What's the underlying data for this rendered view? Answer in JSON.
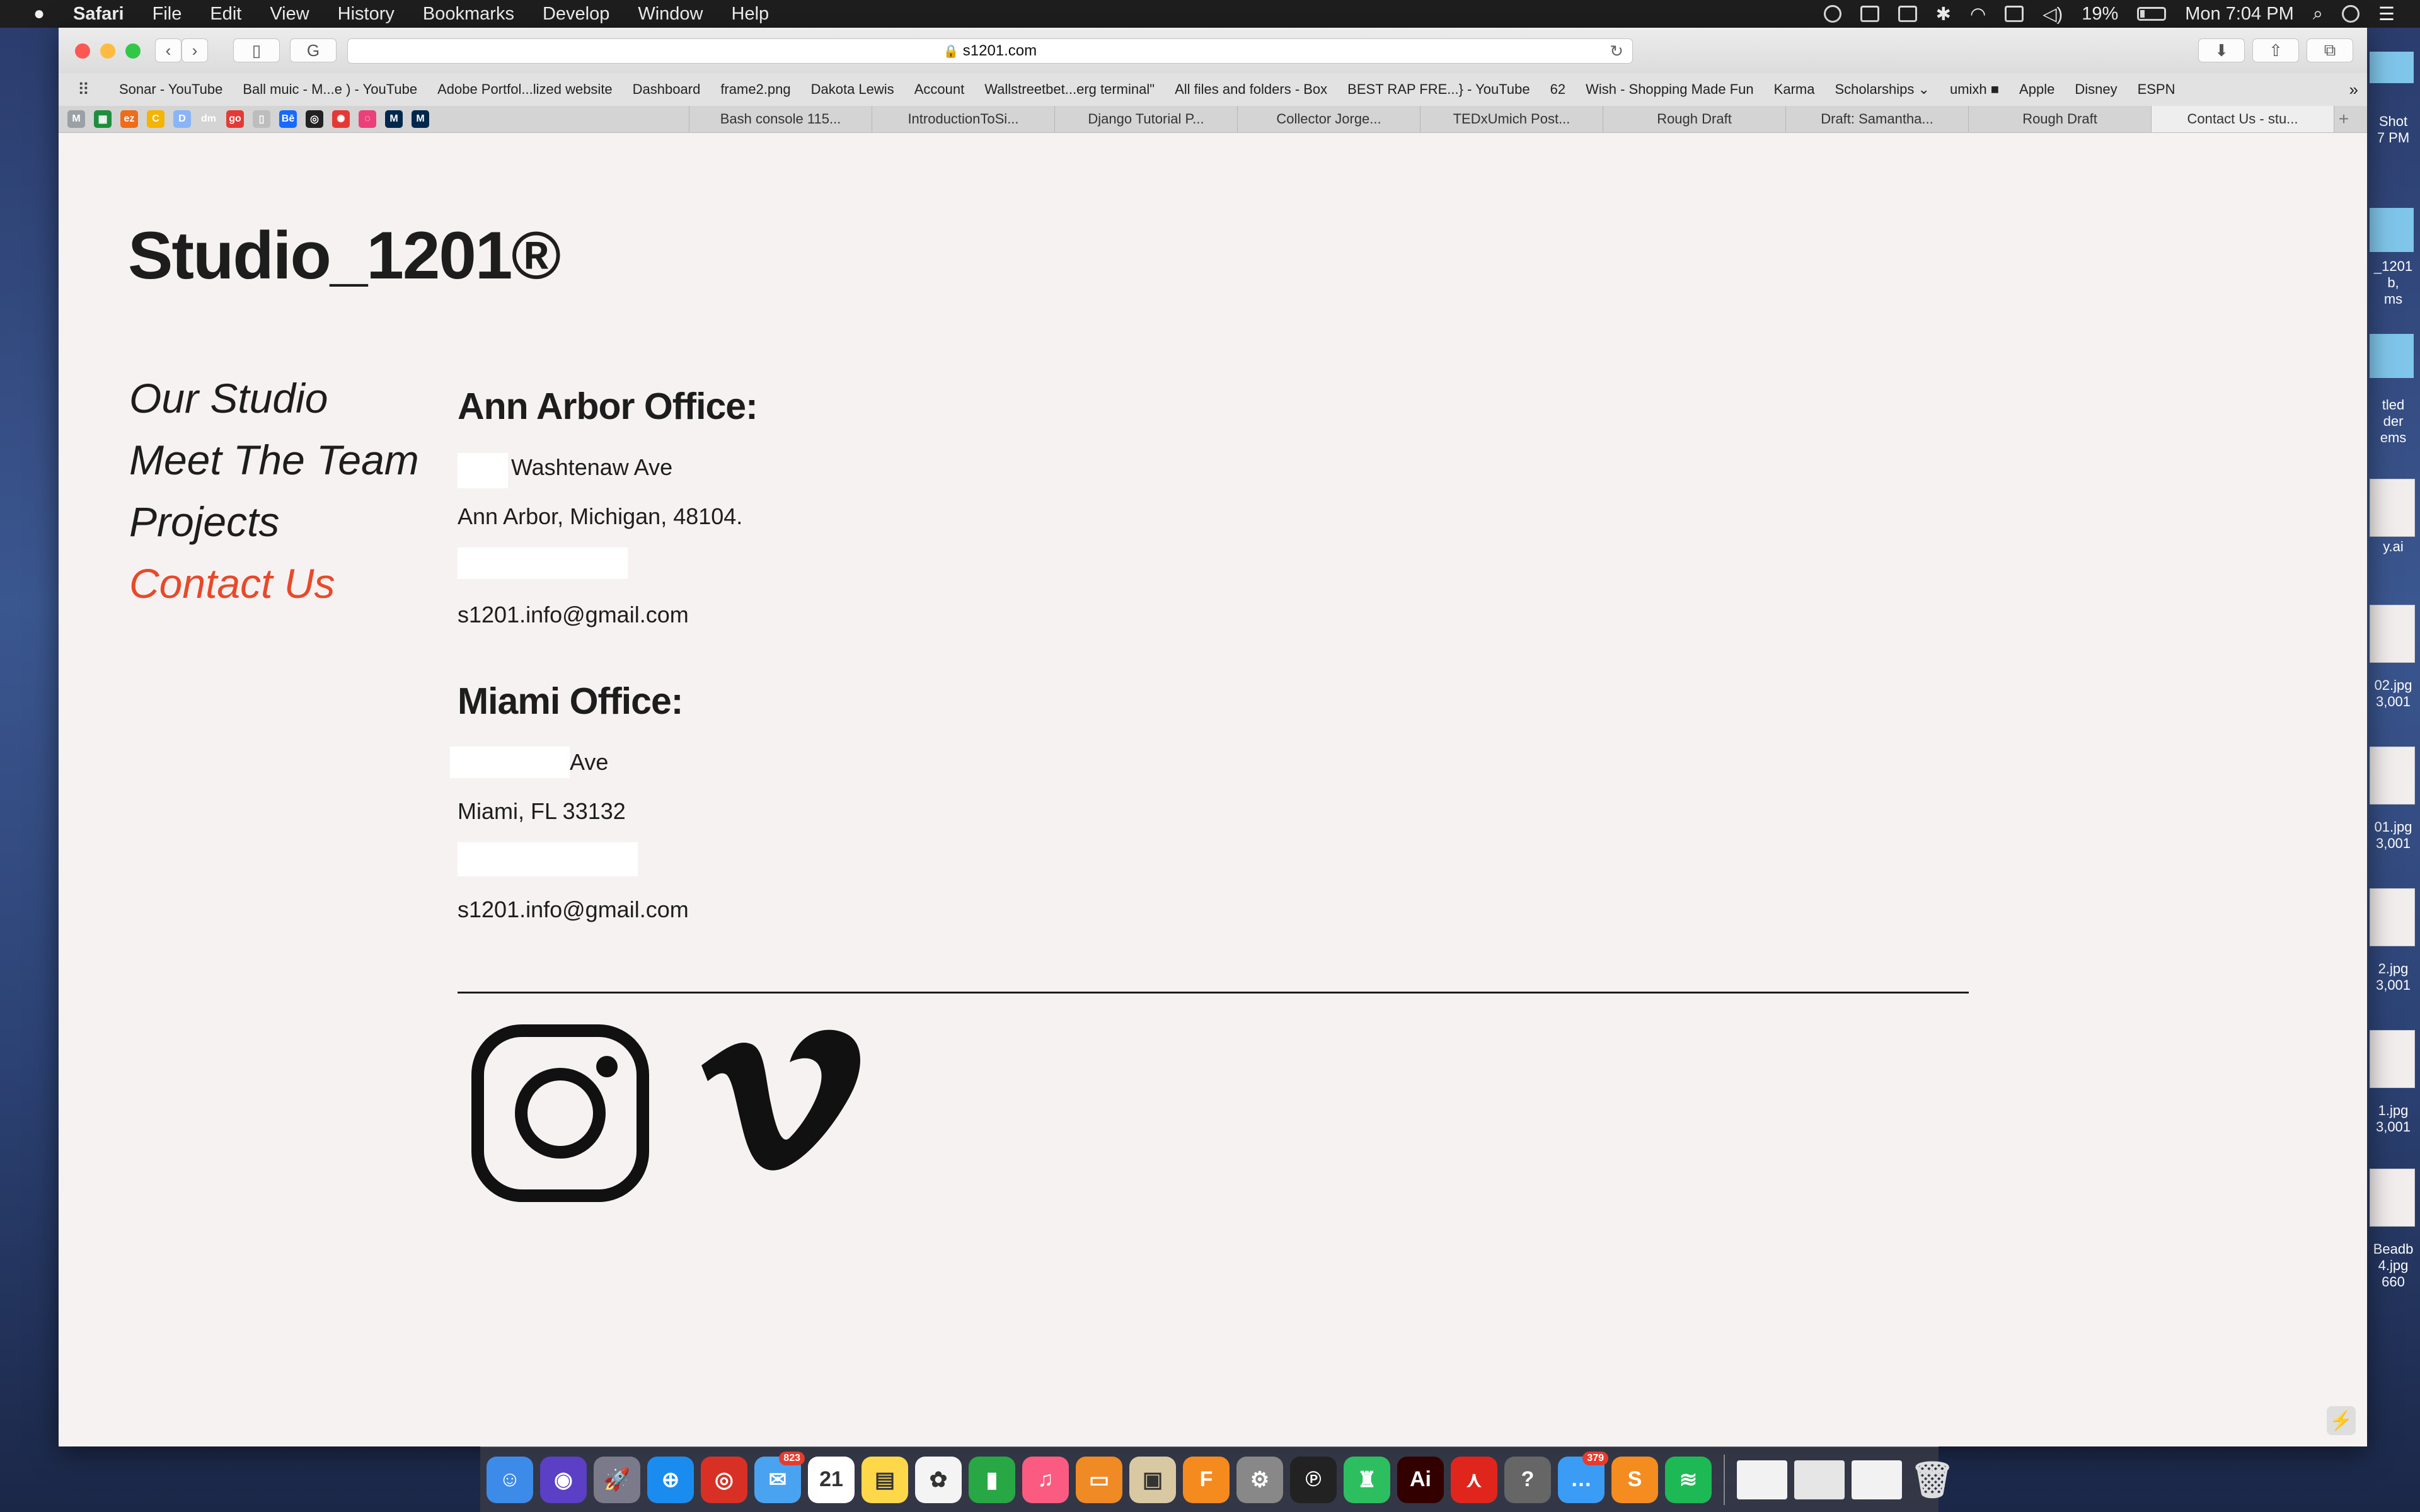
{
  "menubar": {
    "apple": "",
    "app_name": "Safari",
    "menus": [
      "File",
      "Edit",
      "View",
      "History",
      "Bookmarks",
      "Develop",
      "Window",
      "Help"
    ],
    "battery": "19%",
    "clock": "Mon 7:04 PM"
  },
  "browser": {
    "url": "s1201.com",
    "bookmarks": [
      "Sonar - YouTube",
      "Ball muic - M...e ) - YouTube",
      "Adobe Portfol...lized website",
      "Dashboard",
      "frame2.png",
      "Dakota Lewis",
      "Account",
      "Wallstreetbet...erg terminal\"",
      "All files and folders - Box",
      "BEST RAP FRE...} - YouTube",
      "62",
      "Wish - Shopping Made Fun",
      "Karma",
      "Scholarships ⌄",
      "umixh ■",
      "Apple",
      "Disney",
      "ESPN"
    ],
    "pinned_tabs": [
      {
        "label": "M",
        "color": "#9aa0a6"
      },
      {
        "label": "▦",
        "color": "#1e8e3e"
      },
      {
        "label": "ez",
        "color": "#ef6c1a"
      },
      {
        "label": "C",
        "color": "#f4b400"
      },
      {
        "label": "D",
        "color": "#8ab4f8"
      },
      {
        "label": "dm",
        "color": "#d4d4d4"
      },
      {
        "label": "go",
        "color": "#e53935"
      },
      {
        "label": "▯",
        "color": "#bdbdbd"
      },
      {
        "label": "Bē",
        "color": "#1769ff"
      },
      {
        "label": "◎",
        "color": "#222222"
      },
      {
        "label": "✺",
        "color": "#e53935"
      },
      {
        "label": "◌",
        "color": "#ec407a"
      },
      {
        "label": "M",
        "color": "#00274c"
      },
      {
        "label": "M",
        "color": "#00274c"
      }
    ],
    "tabs": [
      "Bash console 115...",
      "IntroductionToSi...",
      "Django Tutorial P...",
      "Collector Jorge...",
      "TEDxUmich Post...",
      "Rough Draft",
      "Draft: Samantha...",
      "Rough Draft",
      "Contact Us - stu..."
    ],
    "active_tab_index": 8
  },
  "site": {
    "logo": "Studio_1201®",
    "nav": [
      "Our Studio",
      "Meet The Team",
      "Projects",
      "Contact Us"
    ],
    "active_nav": "Contact Us",
    "accent_color": "#e8492a",
    "offices": [
      {
        "heading": "Ann Arbor Office:",
        "street": "Washtenaw Ave",
        "city": "Ann Arbor, Michigan, 48104.",
        "email": "s1201.info@gmail.com"
      },
      {
        "heading": "Miami Office:",
        "street": "Ave",
        "city": "Miami, FL 33132",
        "email": "s1201.info@gmail.com"
      }
    ],
    "social": [
      "instagram-icon",
      "vimeo-icon"
    ]
  },
  "desktop_files": [
    "Shot\n7 PM",
    "_1201\nb,\nms",
    "tled\nder\nems",
    "y.ai",
    "02.jpg\n3,001",
    "01.jpg\n3,001",
    "2.jpg\n3,001",
    "1.jpg\n3,001",
    "Beadb\n4.jpg\n660"
  ],
  "dock": {
    "apps": [
      {
        "name": "finder",
        "label": "☺",
        "color": "#3d8be8"
      },
      {
        "name": "siri",
        "label": "◉",
        "color": "#5b3fc4"
      },
      {
        "name": "launchpad",
        "label": "🚀",
        "color": "#7a7a8a"
      },
      {
        "name": "safari",
        "label": "⊕",
        "color": "#1a8cf0"
      },
      {
        "name": "chrome",
        "label": "◎",
        "color": "#d93025"
      },
      {
        "name": "mail",
        "label": "✉",
        "color": "#4aa3f0",
        "badge": "823"
      },
      {
        "name": "calendar",
        "label": "21",
        "color": "#ffffff"
      },
      {
        "name": "notes",
        "label": "▤",
        "color": "#ffd84a"
      },
      {
        "name": "photos",
        "label": "✿",
        "color": "#f4f4f4"
      },
      {
        "name": "numbers",
        "label": "▮",
        "color": "#28a745"
      },
      {
        "name": "itunes",
        "label": "♫",
        "color": "#fb5b80"
      },
      {
        "name": "books",
        "label": "▭",
        "color": "#f08a24"
      },
      {
        "name": "preview",
        "label": "▣",
        "color": "#d9c9a3"
      },
      {
        "name": "fusion",
        "label": "F",
        "color": "#f58a1f"
      },
      {
        "name": "settings",
        "label": "⚙",
        "color": "#888888"
      },
      {
        "name": "pycharm",
        "label": "℗",
        "color": "#222222"
      },
      {
        "name": "evernote",
        "label": "♜",
        "color": "#2dbe60"
      },
      {
        "name": "illustrator",
        "label": "Ai",
        "color": "#330000"
      },
      {
        "name": "acrobat",
        "label": "⋏",
        "color": "#e0261c"
      },
      {
        "name": "help",
        "label": "?",
        "color": "#666666"
      },
      {
        "name": "messages",
        "label": "…",
        "color": "#3b9cf5",
        "badge": "379"
      },
      {
        "name": "sublime",
        "label": "S",
        "color": "#f48c1f"
      },
      {
        "name": "spotify",
        "label": "≋",
        "color": "#1db954"
      }
    ]
  }
}
